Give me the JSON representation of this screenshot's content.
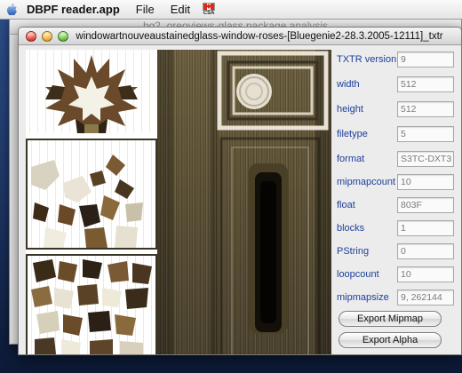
{
  "menubar": {
    "apple_icon": "apple-icon",
    "app_name": "DBPF reader.app",
    "items": [
      "File",
      "Edit"
    ],
    "flag_code": "CSA"
  },
  "background_window": {
    "title": "bg2_oreoviews-glass.package analysis"
  },
  "window": {
    "title": "windowartnouveaustainedglass-window-roses-[Bluegenie2-28.3.2005-12111]_txtr"
  },
  "properties": [
    {
      "label": "TXTR version",
      "value": "9"
    },
    {
      "label": "width",
      "value": "512"
    },
    {
      "label": "height",
      "value": "512"
    },
    {
      "label": "filetype",
      "value": "5"
    },
    {
      "label": "format",
      "value": "S3TC-DXT3"
    },
    {
      "label": "mipmapcount",
      "value": "10"
    },
    {
      "label": "float",
      "value": "803F"
    },
    {
      "label": "blocks",
      "value": "1"
    },
    {
      "label": "PString",
      "value": "0"
    },
    {
      "label": "loopcount",
      "value": "10"
    },
    {
      "label": "mipmapsize",
      "value": "9, 262144"
    }
  ],
  "buttons": {
    "export_mipmap": "Export Mipmap",
    "export_alpha": "Export Alpha"
  },
  "colors": {
    "label_blue": "#1d3f9a",
    "wood": "#5d5236"
  }
}
